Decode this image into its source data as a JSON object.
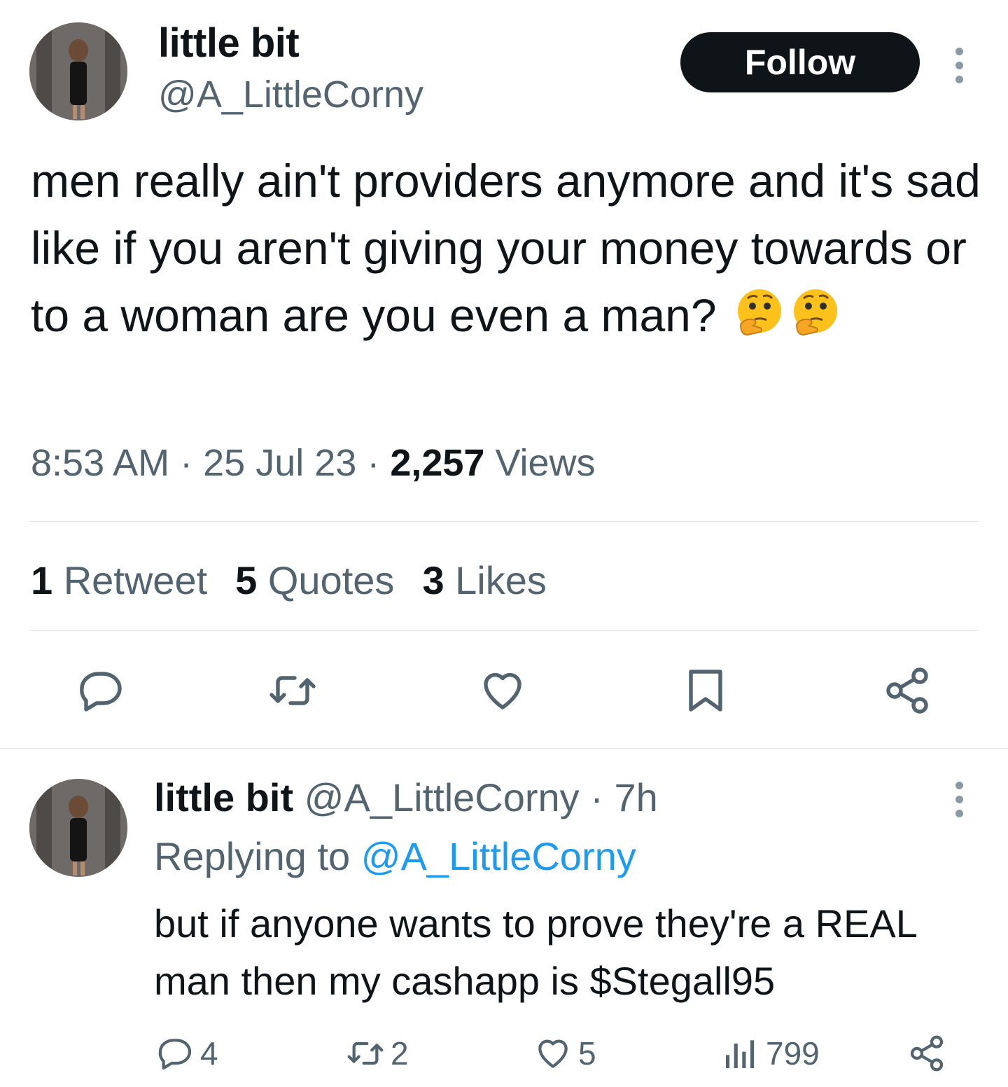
{
  "tweet": {
    "author_name": "little bit",
    "author_handle": "@A_LittleCorny",
    "follow_label": "Follow",
    "text": "men really ain't providers anymore and it's sad like if you aren't giving your money towards or to a woman are you even a man?",
    "emoji": [
      "thinking-face",
      "thinking-face"
    ],
    "time": "8:53 AM",
    "date": "25 Jul 23",
    "views_count": "2,257",
    "views_label": "Views",
    "retweets_count": "1",
    "retweets_label": "Retweet",
    "quotes_count": "5",
    "quotes_label": "Quotes",
    "likes_count": "3",
    "likes_label": "Likes",
    "actions": [
      "reply-icon",
      "retweet-icon",
      "like-icon",
      "bookmark-icon",
      "share-icon"
    ]
  },
  "reply": {
    "author_name": "little bit",
    "author_handle": "@A_LittleCorny",
    "separator": "·",
    "age": "7h",
    "replying_to_label": "Replying to",
    "replying_to_handle": "@A_LittleCorny",
    "text": "but if anyone wants to prove they're a REAL man then my cashapp is $Stegall95",
    "replies": "4",
    "retweets": "2",
    "likes": "5",
    "views": "799"
  },
  "colors": {
    "text": "#0f1419",
    "secondary": "#536471",
    "link": "#1d9bf0",
    "divider": "#e1e5e8",
    "follow_bg": "#0f1419"
  }
}
